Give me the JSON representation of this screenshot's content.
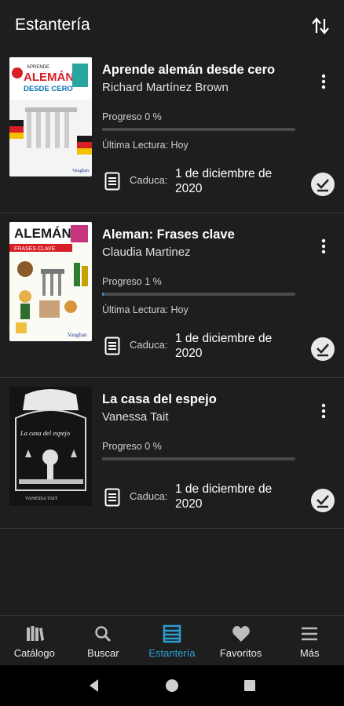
{
  "appbar": {
    "title": "Estantería",
    "sort_icon": "sort-arrows-icon"
  },
  "books": [
    {
      "title": "Aprende alemán desde cero",
      "author": "Richard Martínez Brown",
      "progress_label": "Progreso 0 %",
      "progress": 0.0,
      "last_read": "Última Lectura: Hoy",
      "expires_label": "Caduca:",
      "expires_date": "1 de diciembre de 2020",
      "cover": {
        "top_text": "APRENDE",
        "big_text": "ALEMÁN",
        "sub_text": "DESDE CERO",
        "publisher": "Vaughan"
      }
    },
    {
      "title": "Aleman: Frases clave",
      "author": "Claudia Martinez",
      "progress_label": "Progreso 1 %",
      "progress": 0.01,
      "last_read": "Última Lectura: Hoy",
      "expires_label": "Caduca:",
      "expires_date": "1 de diciembre de 2020",
      "cover": {
        "big_text": "ALEMÁN",
        "sub_text": "FRASES CLAVE",
        "publisher": "Vaughan"
      }
    },
    {
      "title": "La casa del espejo",
      "author": "Vanessa Tait",
      "progress_label": "Progreso 0 %",
      "progress": 0.0,
      "expires_label": "Caduca:",
      "expires_date": "1 de diciembre de 2020",
      "cover": {
        "big_text": "La casa del espejo",
        "author_text": "VANESSA TAIT"
      }
    }
  ],
  "nav": [
    {
      "label": "Catálogo",
      "icon": "books-icon",
      "active": false
    },
    {
      "label": "Buscar",
      "icon": "search-icon",
      "active": false
    },
    {
      "label": "Estantería",
      "icon": "shelf-icon",
      "active": true
    },
    {
      "label": "Favoritos",
      "icon": "heart-icon",
      "active": false
    },
    {
      "label": "Más",
      "icon": "menu-icon",
      "active": false
    }
  ],
  "colors": {
    "background": "#1e1e1e",
    "accent": "#2a9fd6",
    "track": "#4a4a4a"
  }
}
